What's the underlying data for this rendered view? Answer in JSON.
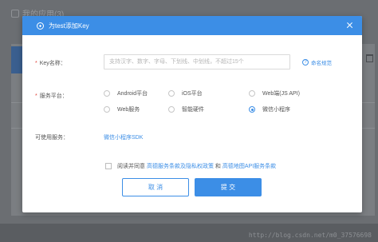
{
  "background": {
    "title": "我的应用(3)",
    "watermark": "http://blog.csdn.net/m0_37576698"
  },
  "dialog": {
    "title": "为test添加Key",
    "key_name": {
      "label": "Key名称：",
      "placeholder": "支持汉字、数字、字母、下划线、中划线，不超过15个",
      "value": ""
    },
    "naming_link": "命名规范",
    "platform": {
      "label": "服务平台：",
      "options": [
        {
          "label": "Android平台",
          "checked": false
        },
        {
          "label": "iOS平台",
          "checked": false
        },
        {
          "label": "Web端(JS API)",
          "checked": false
        },
        {
          "label": "Web服务",
          "checked": false
        },
        {
          "label": "智能硬件",
          "checked": false
        },
        {
          "label": "微信小程序",
          "checked": true
        }
      ]
    },
    "services": {
      "label": "可使用服务：",
      "value": "微信小程序SDK"
    },
    "agreement": {
      "prefix": "阅读并同意",
      "link1": "高德服务条款及隐私权政策",
      "conj": "和",
      "link2": "高德地图API服务条款",
      "checked": false
    },
    "cancel_label": "取 消",
    "submit_label": "提 交"
  },
  "colors": {
    "accent": "#3c8ee6",
    "required": "#e0463c"
  }
}
